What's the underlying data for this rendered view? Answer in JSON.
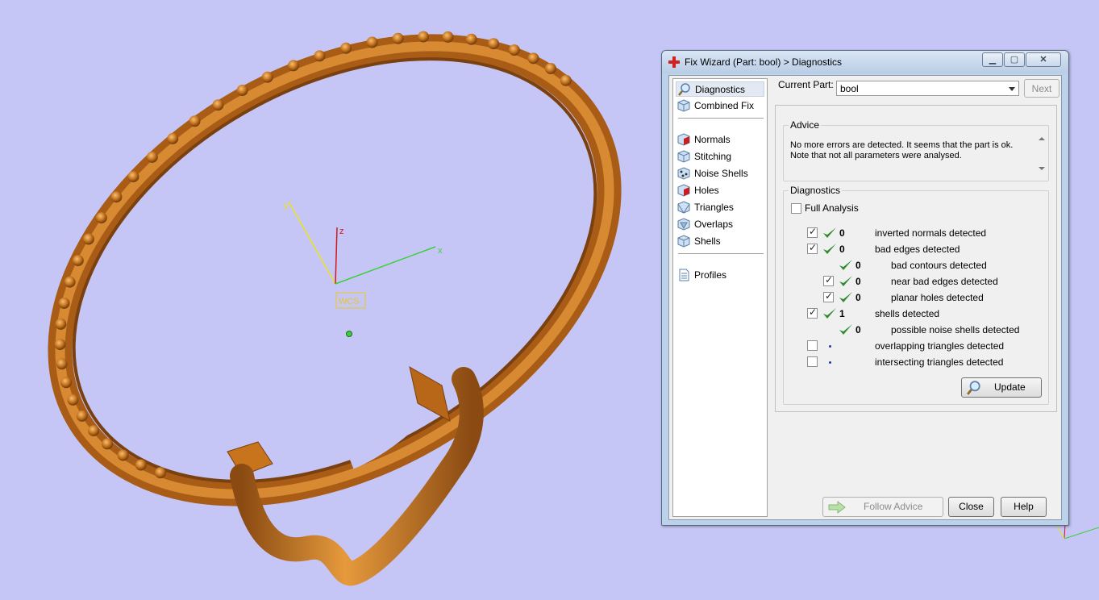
{
  "viewport": {
    "axes": {
      "x_label": "x",
      "y_label": "y",
      "z_label": "z",
      "wcs_label": "WCS"
    }
  },
  "window": {
    "title": "Fix Wizard (Part: bool) > Diagnostics",
    "controls": {
      "minimize": "▁",
      "maximize": "▢",
      "close": "✕"
    }
  },
  "nav": {
    "items": [
      {
        "label": "Diagnostics",
        "icon": "magnifier-icon",
        "selected": true
      },
      {
        "label": "Combined Fix",
        "icon": "cube-icon"
      },
      {
        "label": "Normals",
        "icon": "normals-cube-icon"
      },
      {
        "label": "Stitching",
        "icon": "stitching-cube-icon"
      },
      {
        "label": "Noise Shells",
        "icon": "noise-shells-icon"
      },
      {
        "label": "Holes",
        "icon": "holes-cube-icon"
      },
      {
        "label": "Triangles",
        "icon": "triangles-cube-icon"
      },
      {
        "label": "Overlaps",
        "icon": "overlaps-cube-icon"
      },
      {
        "label": "Shells",
        "icon": "shells-cube-icon"
      },
      {
        "label": "Profiles",
        "icon": "document-icon"
      }
    ]
  },
  "current_part": {
    "label": "Current Part:",
    "value": "bool"
  },
  "buttons": {
    "next": "Next",
    "update": "Update",
    "follow_advice": "Follow Advice",
    "close": "Close",
    "help": "Help"
  },
  "advice": {
    "title": "Advice",
    "line1": "No more errors are detected. It seems that the part is ok.",
    "line2": "Note that not all parameters were analysed."
  },
  "diagnostics": {
    "title": "Diagnostics",
    "full_analysis": {
      "label": "Full Analysis",
      "checked": false
    },
    "rows": [
      {
        "checkbox": true,
        "checked": true,
        "status": "ok",
        "count": "0",
        "text": "inverted normals detected"
      },
      {
        "checkbox": true,
        "checked": true,
        "status": "ok",
        "count": "0",
        "text": "bad edges detected"
      },
      {
        "checkbox": false,
        "status": "ok",
        "count": "0",
        "text": "bad contours detected"
      },
      {
        "checkbox": true,
        "checked": true,
        "status": "ok",
        "count": "0",
        "text": "near bad edges detected"
      },
      {
        "checkbox": true,
        "checked": true,
        "status": "ok",
        "count": "0",
        "text": "planar holes detected"
      },
      {
        "checkbox": true,
        "checked": true,
        "status": "ok",
        "count": "1",
        "text": "shells detected"
      },
      {
        "checkbox": false,
        "status": "ok",
        "count": "0",
        "text": "possible noise shells detected"
      },
      {
        "checkbox": true,
        "checked": false,
        "status": "unknown",
        "count": "",
        "text": "overlapping triangles detected"
      },
      {
        "checkbox": true,
        "checked": false,
        "status": "unknown",
        "count": "",
        "text": "intersecting triangles detected"
      }
    ]
  },
  "colors": {
    "background": "#c6c6f6",
    "model": "#c8741c",
    "check_green": "#2e8b2e"
  }
}
